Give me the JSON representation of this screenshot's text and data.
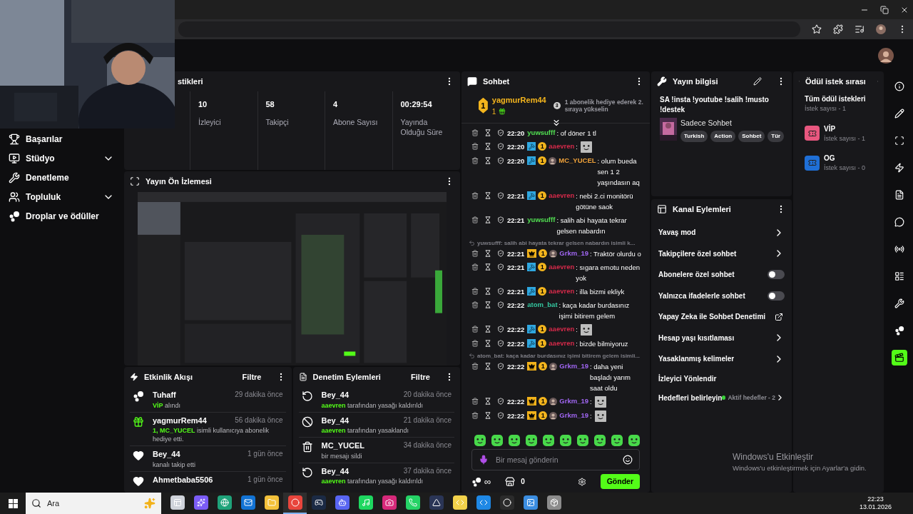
{
  "sidebar": {
    "items": [
      {
        "label": "Başarılar"
      },
      {
        "label": "Stüdyo",
        "expanded": false
      },
      {
        "label": "Denetleme"
      },
      {
        "label": "Topluluk",
        "expanded": false
      },
      {
        "label": "Droplar ve ödüller"
      }
    ]
  },
  "stats": {
    "title": "stikleri",
    "items": [
      {
        "value": "10",
        "label": "İzleyici"
      },
      {
        "value": "58",
        "label": "Takipçi"
      },
      {
        "value": "4",
        "label": "Abone Sayısı"
      },
      {
        "value": "00:29:54",
        "label": "Yayında Olduğu Süre"
      }
    ]
  },
  "preview": {
    "title": "Yayın Ön İzlemesi"
  },
  "activity": {
    "title": "Etkinlik Akışı",
    "filter": "Filtre",
    "items": [
      {
        "kind": "reward",
        "name": "Tuhaff",
        "time": "29 dakika önce",
        "detail": "**VİP** alındı"
      },
      {
        "kind": "gift",
        "name": "yagmurRem44",
        "time": "56 dakika önce",
        "detail": "**1, MC_YUCEL** isimli kullanıcıya abonelik hediye etti."
      },
      {
        "kind": "follow",
        "name": "Bey_44",
        "time": "1 gün önce",
        "detail": "kanalı takip etti"
      },
      {
        "kind": "follow",
        "name": "Ahmetbaba5506",
        "time": "1 gün önce"
      }
    ]
  },
  "moderation": {
    "title": "Denetim Eylemleri",
    "filter": "Filtre",
    "items": [
      {
        "kind": "unban",
        "name": "Bey_44",
        "time": "20 dakika önce",
        "detail": "**aaevren** tarafından yasağı kaldırıldı"
      },
      {
        "kind": "ban",
        "name": "Bey_44",
        "time": "21 dakika önce",
        "detail": "**aaevren** tarafından yasaklandı"
      },
      {
        "kind": "delete",
        "name": "MC_YUCEL",
        "time": "34 dakika önce",
        "detail": "bir mesajı sildi"
      },
      {
        "kind": "unban",
        "name": "Bey_44",
        "time": "37 dakika önce",
        "detail": "**aaevren** tarafından yasağı kaldırıldı"
      }
    ]
  },
  "chat": {
    "title": "Sohbet",
    "top_gifter": {
      "rank": "1",
      "user": "yagmurRem44",
      "count": "1",
      "next_rank": "3",
      "hint": "1 abonelik hediye ederek 2. sıraya yükselin"
    },
    "messages": [
      {
        "time": "22:20",
        "user": "yuwsufff",
        "color": "#52e052",
        "text": ": of döner 1 tl"
      },
      {
        "time": "22:20",
        "badges": [
          {
            "kind": "mod"
          },
          {
            "kind": "sub",
            "label": "1"
          }
        ],
        "user": "aaevren",
        "color": "#d62a4a",
        "text": ":",
        "emote": true
      },
      {
        "time": "22:20",
        "badges": [
          {
            "kind": "mod"
          },
          {
            "kind": "sub",
            "label": "1"
          },
          {
            "kind": "avatar"
          }
        ],
        "user": "MC_YUCEL",
        "color": "#f0a23a",
        "text": ": olum bueda sen 1 2 yaşındasın aq"
      },
      {
        "time": "22:21",
        "badges": [
          {
            "kind": "mod"
          },
          {
            "kind": "sub",
            "label": "1"
          }
        ],
        "user": "aaevren",
        "color": "#d62a4a",
        "text": ": nebi 2.ci monitörü götüne saok"
      },
      {
        "time": "22:21",
        "user": "yuwsufff",
        "color": "#52e052",
        "text": ": salih abi hayata tekrar gelsen nabardın"
      },
      {
        "reply": "yuwsufff: salih abi hayata tekrar gelsen nabardın isimli k...",
        "time": "22:21",
        "badges": [
          {
            "kind": "crown"
          },
          {
            "kind": "sub",
            "label": "1"
          },
          {
            "kind": "avatar"
          }
        ],
        "user": "Grkm_19",
        "color": "#a066f2",
        "text": ": Traktör olurdu o"
      },
      {
        "time": "22:21",
        "badges": [
          {
            "kind": "mod"
          },
          {
            "kind": "sub",
            "label": "1"
          }
        ],
        "user": "aaevren",
        "color": "#d62a4a",
        "text": ": sıgara emotu neden yok"
      },
      {
        "time": "22:21",
        "badges": [
          {
            "kind": "mod"
          },
          {
            "kind": "sub",
            "label": "1"
          }
        ],
        "user": "aaevren",
        "color": "#d62a4a",
        "text": ": illa bizmi ekliyk"
      },
      {
        "time": "22:22",
        "user": "atom_bat",
        "color": "#34c7a0",
        "text": ": kaça kadar burdasınız işimi bitirem gelem"
      },
      {
        "time": "22:22",
        "badges": [
          {
            "kind": "mod"
          },
          {
            "kind": "sub",
            "label": "1"
          }
        ],
        "user": "aaevren",
        "color": "#d62a4a",
        "text": ":",
        "emote": true
      },
      {
        "time": "22:22",
        "badges": [
          {
            "kind": "mod"
          },
          {
            "kind": "sub",
            "label": "1"
          }
        ],
        "user": "aaevren",
        "color": "#d62a4a",
        "text": ": bizde bilmiyoruz"
      },
      {
        "reply": "atom_bat: kaça kadar burdasınız işimi bitirem gelem isimli...",
        "time": "22:22",
        "badges": [
          {
            "kind": "crown"
          },
          {
            "kind": "sub",
            "label": "1"
          },
          {
            "kind": "avatar"
          }
        ],
        "user": "Grkm_19",
        "color": "#a066f2",
        "text": ": daha yeni başladı yarım saat oldu"
      },
      {
        "time": "22:22",
        "badges": [
          {
            "kind": "crown"
          },
          {
            "kind": "sub",
            "label": "1"
          },
          {
            "kind": "avatar"
          }
        ],
        "user": "Grkm_19",
        "color": "#a066f2",
        "text": ":",
        "emote": true
      },
      {
        "time": "22:22",
        "badges": [
          {
            "kind": "crown"
          },
          {
            "kind": "sub",
            "label": "1"
          },
          {
            "kind": "avatar"
          }
        ],
        "user": "Grkm_19",
        "color": "#a066f2",
        "text": ":",
        "emote": true
      }
    ],
    "input": {
      "placeholder": "Bir mesaj gönderin"
    },
    "points": "∞",
    "store_count": "0",
    "send": "Gönder"
  },
  "stream_info": {
    "title": "Yayın bilgisi",
    "stream_title": "SA !insta !youtube !salih !musto !destek",
    "category": "Sadece Sohbet",
    "tags": [
      "Turkish",
      "Action",
      "Sohbet",
      "Tür"
    ]
  },
  "channel_actions": {
    "title": "Kanal Eylemleri",
    "items": [
      {
        "kind": "arrow",
        "label": "Yavaş mod"
      },
      {
        "kind": "arrow",
        "label": "Takipçilere özel sohbet"
      },
      {
        "kind": "toggle",
        "label": "Abonelere özel sohbet",
        "on": false
      },
      {
        "kind": "toggle",
        "label": "Yalnızca ifadelerle sohbet",
        "on": false
      },
      {
        "kind": "external",
        "label": "Yapay Zeka ile Sohbet Denetimi"
      },
      {
        "kind": "arrow",
        "label": "Hesap yaşı kısıtlaması"
      },
      {
        "kind": "arrow",
        "label": "Yasaklanmış kelimeler"
      },
      {
        "kind": "plain",
        "label": "İzleyici Yönlendir"
      },
      {
        "kind": "goal",
        "label": "Hedefleri belirleyin",
        "status": "Aktif hedefler - 2"
      }
    ]
  },
  "reward_queue": {
    "title": "Ödül istek sırası",
    "all": "Tüm ödül istekleri",
    "all_count": "İstek sayısı - 1",
    "items": [
      {
        "name": "VİP",
        "count": "İstek sayısı - 1",
        "color": "#e8577f"
      },
      {
        "name": "OG",
        "count": "İstek sayısı - 0",
        "color": "#1f6fd6"
      }
    ]
  },
  "rail": [
    {
      "selected": false
    },
    {
      "selected": false
    },
    {
      "selected": false
    },
    {
      "selected": false
    },
    {
      "selected": false
    },
    {
      "selected": false
    },
    {
      "selected": false
    },
    {
      "selected": false
    },
    {
      "selected": false
    },
    {
      "selected": false
    },
    {
      "selected": true
    }
  ],
  "os_notice": {
    "title": "Windows'u Etkinleştir",
    "text": "Windows'u etkinleştirmek için Ayarlar'a gidin."
  },
  "taskbar": {
    "search": "Ara",
    "apps": [
      {
        "selected": false
      },
      {
        "selected": false
      },
      {
        "selected": false
      },
      {
        "selected": false
      },
      {
        "selected": false
      },
      {
        "selected": true
      },
      {
        "selected": false
      },
      {
        "selected": false
      },
      {
        "selected": false
      },
      {
        "selected": false
      },
      {
        "selected": false
      },
      {
        "selected": false
      },
      {
        "selected": false
      },
      {
        "selected": false
      },
      {
        "selected": false
      },
      {
        "selected": false
      },
      {
        "selected": false
      }
    ],
    "time": "22:23",
    "date": "13.01.2026"
  }
}
